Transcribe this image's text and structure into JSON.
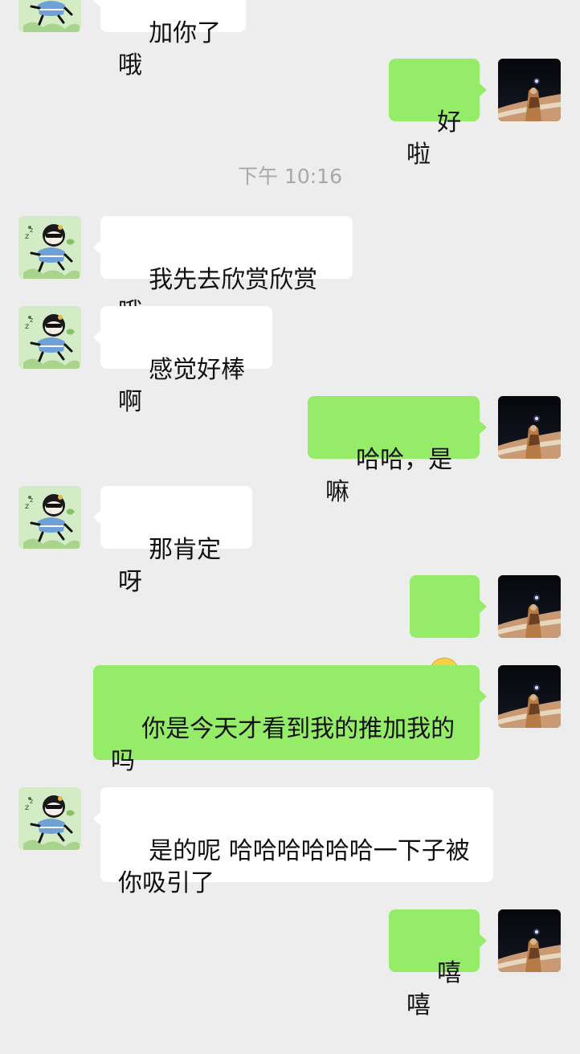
{
  "chat": {
    "timestamp": "下午 10:16",
    "messages": [
      {
        "side": "left",
        "text": "加你了哦"
      },
      {
        "side": "right",
        "text": "好啦"
      },
      {
        "side": "left",
        "text": "我先去欣赏欣赏哦"
      },
      {
        "side": "left",
        "text": "感觉好棒啊"
      },
      {
        "side": "right",
        "text": "哈哈，是嘛"
      },
      {
        "side": "left",
        "text": "那肯定呀"
      },
      {
        "side": "right",
        "emoji": "smiling-face"
      },
      {
        "side": "right",
        "text": "你是今天才看到我的推加我的\n吗"
      },
      {
        "side": "left",
        "text": "是的呢 哈哈哈哈哈哈一下子被\n你吸引了"
      },
      {
        "side": "right",
        "text": "嘻嘻"
      }
    ]
  },
  "colors": {
    "background": "#ededed",
    "bubble_self": "#95ec69",
    "bubble_other": "#ffffff",
    "timestamp_text": "#a8a8a8"
  },
  "icons": {
    "other_avatar": "cartoon-character-avatar-icon",
    "self_avatar": "night-sky-photo-avatar-icon",
    "emoji": "smiling-face-emoji-icon"
  }
}
